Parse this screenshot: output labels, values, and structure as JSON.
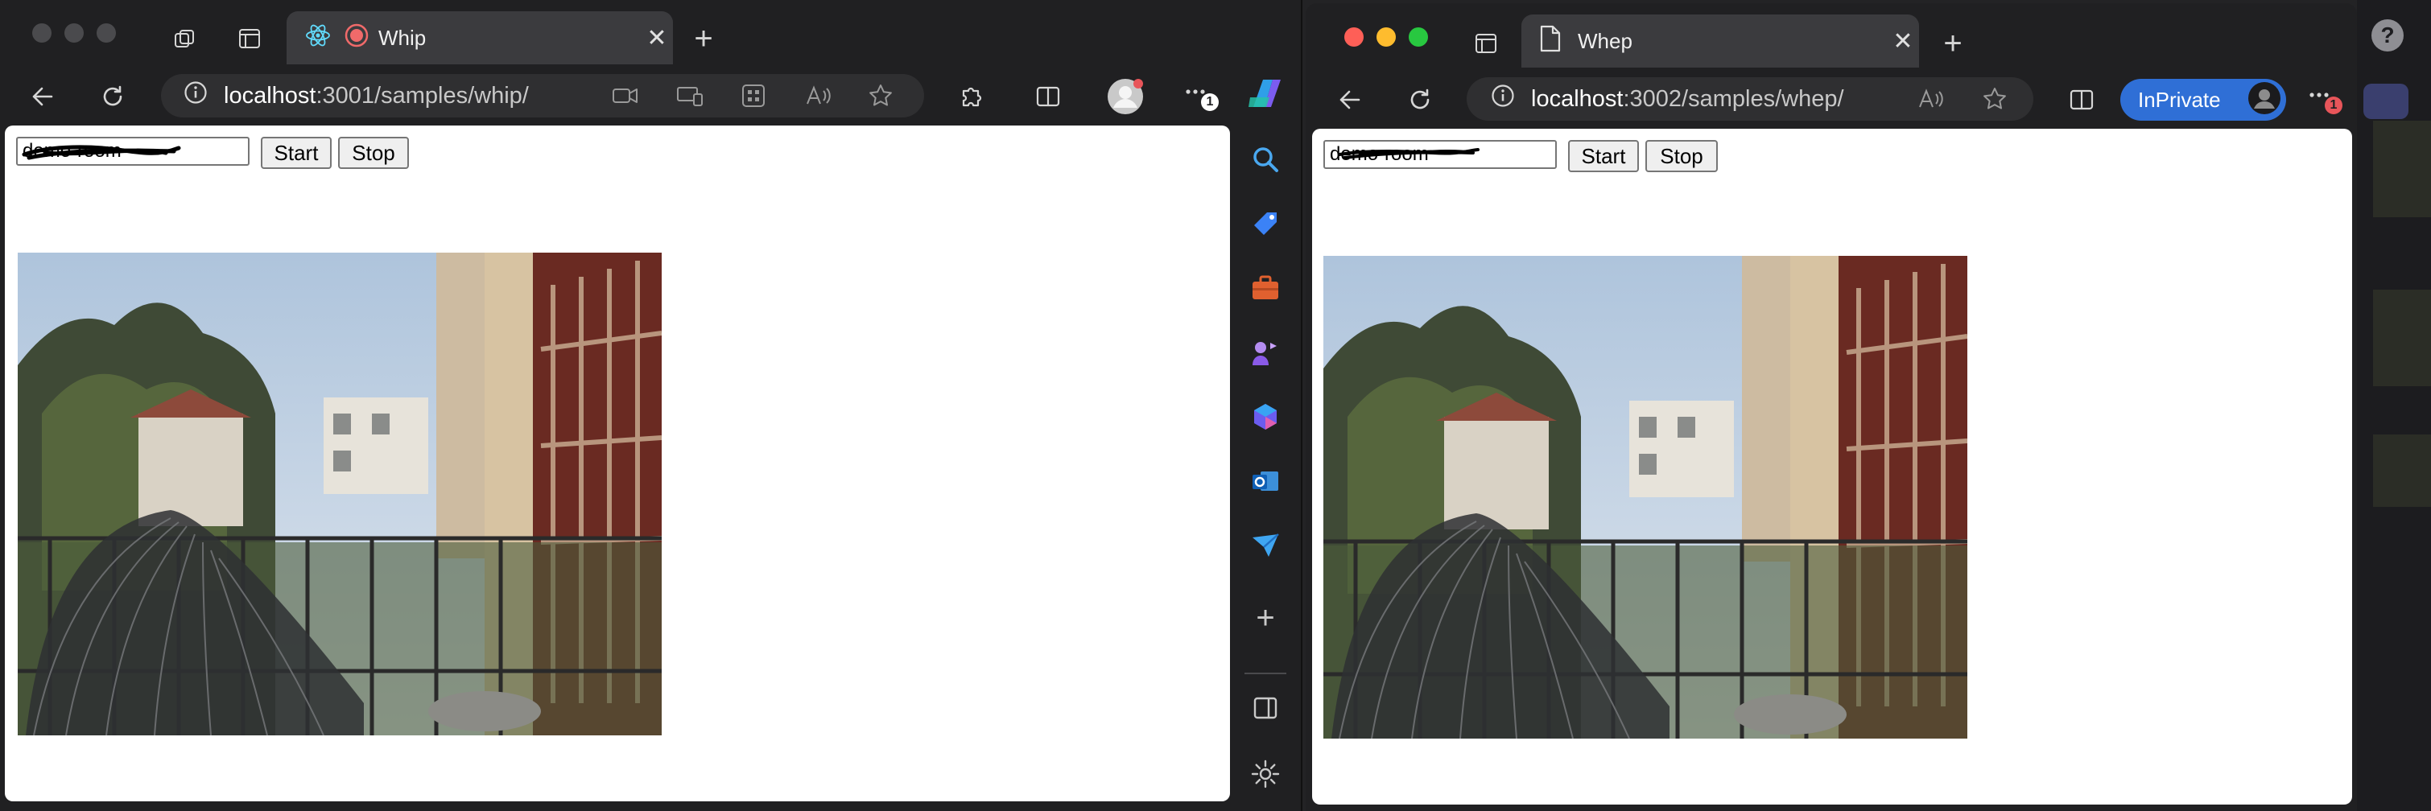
{
  "left_window": {
    "tab_title": "Whip",
    "address": {
      "host": "localhost",
      "rest": ":3001/samples/whip/"
    },
    "form": {
      "room_value": "demo-room",
      "start_label": "Start",
      "stop_label": "Stop"
    },
    "notification_badge": "1"
  },
  "right_window": {
    "tab_title": "Whep",
    "address": {
      "host": "localhost",
      "rest": ":3002/samples/whep/"
    },
    "inprivate_label": "InPrivate",
    "form": {
      "room_value": "demo-room",
      "start_label": "Start",
      "stop_label": "Stop"
    },
    "notification_badge": "1"
  },
  "right_edge": {
    "help_label": "?"
  },
  "colors": {
    "accent_blue": "#2f6fd6",
    "close_red": "#fe5f57",
    "page_bg": "#ffffff"
  }
}
